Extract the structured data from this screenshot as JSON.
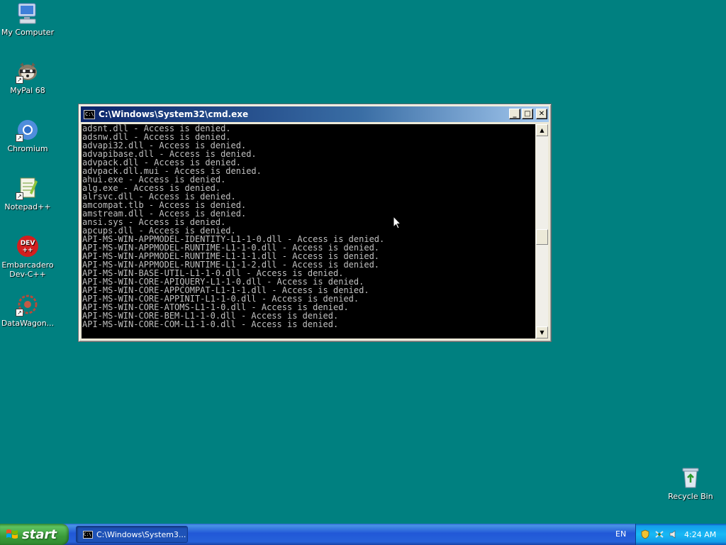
{
  "desktop": {
    "icons": [
      {
        "label": "My Computer",
        "icon": "computer-icon"
      },
      {
        "label": "MyPal 68",
        "icon": "raccoon-icon"
      },
      {
        "label": "Chromium",
        "icon": "chromium-icon"
      },
      {
        "label": "Notepad++",
        "icon": "notepadpp-icon"
      },
      {
        "label_line1": "Embarcadero",
        "label_line2": "Dev-C++",
        "icon_text": "DEV\n++",
        "icon": "devcpp-icon"
      },
      {
        "label": "DataWagon...",
        "icon": "datawagon-icon"
      },
      {
        "label": "Recycle Bin",
        "icon": "recycle-bin-icon"
      }
    ]
  },
  "cmd_window": {
    "title": "C:\\Windows\\System32\\cmd.exe",
    "icon_text": "C:\\",
    "minimize_label": "_",
    "maximize_label": "□",
    "close_label": "✕",
    "lines": [
      "adsnt.dll - Access is denied.",
      "adsnw.dll - Access is denied.",
      "advapi32.dll - Access is denied.",
      "advapibase.dll - Access is denied.",
      "advpack.dll - Access is denied.",
      "advpack.dll.mui - Access is denied.",
      "ahui.exe - Access is denied.",
      "alg.exe - Access is denied.",
      "alrsvc.dll - Access is denied.",
      "amcompat.tlb - Access is denied.",
      "amstream.dll - Access is denied.",
      "ansi.sys - Access is denied.",
      "apcups.dll - Access is denied.",
      "API-MS-WIN-APPMODEL-IDENTITY-L1-1-0.dll - Access is denied.",
      "API-MS-WIN-APPMODEL-RUNTIME-L1-1-0.dll - Access is denied.",
      "API-MS-WIN-APPMODEL-RUNTIME-L1-1-1.dll - Access is denied.",
      "API-MS-WIN-APPMODEL-RUNTIME-L1-1-2.dll - Access is denied.",
      "API-MS-WIN-BASE-UTIL-L1-1-0.dll - Access is denied.",
      "API-MS-WIN-CORE-APIQUERY-L1-1-0.dll - Access is denied.",
      "API-MS-WIN-CORE-APPCOMPAT-L1-1-1.dll - Access is denied.",
      "API-MS-WIN-CORE-APPINIT-L1-1-0.dll - Access is denied.",
      "API-MS-WIN-CORE-ATOMS-L1-1-0.dll - Access is denied.",
      "API-MS-WIN-CORE-BEM-L1-1-0.dll - Access is denied.",
      "API-MS-WIN-CORE-COM-L1-1-0.dll - Access is denied."
    ],
    "scroll_up_glyph": "▲",
    "scroll_down_glyph": "▼"
  },
  "taskbar": {
    "start_label": "start",
    "task_label": "C:\\Windows\\System3...",
    "language": "EN",
    "clock": "4:24 AM"
  },
  "colors": {
    "desktop": "#008080",
    "console_bg": "#000000",
    "console_text": "#c0c0c0"
  }
}
